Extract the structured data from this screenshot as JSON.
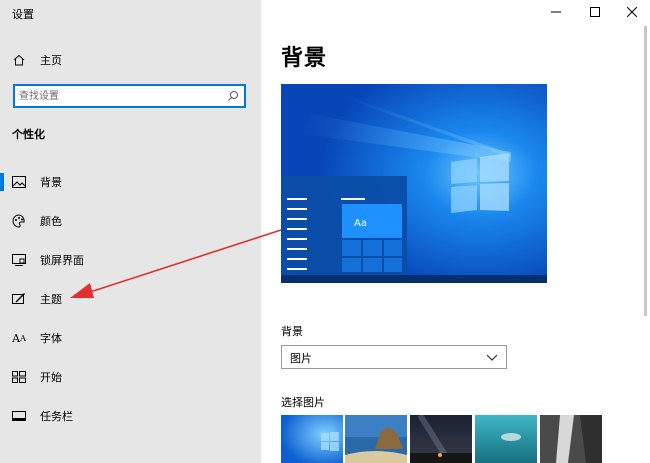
{
  "window": {
    "title": "设置",
    "controls": {
      "minimize": "—",
      "maximize": "☐",
      "close": "✕"
    }
  },
  "sidebar": {
    "home_label": "主页",
    "search_placeholder": "查找设置",
    "section_title": "个性化",
    "items": [
      {
        "label": "背景",
        "icon": "picture-icon",
        "active": true
      },
      {
        "label": "颜色",
        "icon": "palette-icon",
        "active": false
      },
      {
        "label": "锁屏界面",
        "icon": "lock-screen-icon",
        "active": false
      },
      {
        "label": "主题",
        "icon": "theme-brush-icon",
        "active": false
      },
      {
        "label": "字体",
        "icon": "font-icon",
        "active": false
      },
      {
        "label": "开始",
        "icon": "start-icon",
        "active": false
      },
      {
        "label": "任务栏",
        "icon": "taskbar-icon",
        "active": false
      }
    ]
  },
  "main": {
    "title": "背景",
    "preview_sample_text": "Aa",
    "background_label": "背景",
    "background_value": "图片",
    "choose_picture_label": "选择图片"
  },
  "colors": {
    "accent": "#0078d7",
    "sidebar_bg": "#e6e6e6",
    "annotation": "#e03030"
  }
}
